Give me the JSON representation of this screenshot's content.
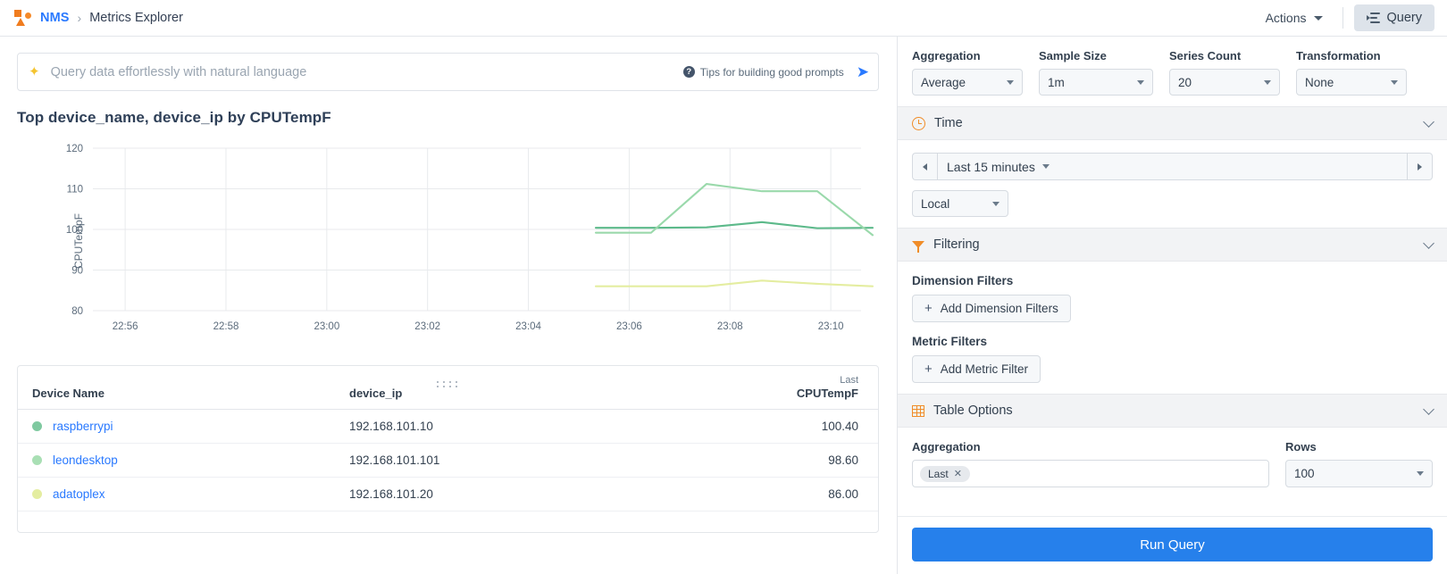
{
  "topbar": {
    "logo_icon": "nms-logo-icon",
    "breadcrumb_root": "NMS",
    "breadcrumb_separator": "›",
    "breadcrumb_current": "Metrics Explorer",
    "actions_label": "Actions",
    "query_label": "Query"
  },
  "nl_query": {
    "sparkle_icon": "sparkle-icon",
    "value": "",
    "placeholder": "Query data effortlessly with natural language",
    "tips_label": "Tips for building good prompts",
    "help_glyph": "?",
    "send_glyph": "➤"
  },
  "chart": {
    "title": "Top device_name, device_ip by CPUTempF"
  },
  "chart_data": {
    "type": "line",
    "title": "Top device_name, device_ip by CPUTempF",
    "xlabel": "",
    "ylabel": "CPUTempF",
    "ylim": [
      80,
      120
    ],
    "yticks": [
      80,
      90,
      100,
      110,
      120
    ],
    "xticks": [
      "22:56",
      "22:58",
      "23:00",
      "23:02",
      "23:04",
      "23:06",
      "23:08",
      "23:10"
    ],
    "grid": true,
    "legend": "none",
    "x": [
      "23:05",
      "23:06",
      "23:07",
      "23:08",
      "23:09",
      "23:10"
    ],
    "series": [
      {
        "name": "raspberrypi",
        "color": "#5cb98a",
        "values": [
          100.4,
          100.4,
          100.5,
          101.8,
          100.3,
          100.4
        ]
      },
      {
        "name": "leondesktop",
        "color": "#9ad9ab",
        "values": [
          99.2,
          99.2,
          111.2,
          109.4,
          109.4,
          98.6
        ]
      },
      {
        "name": "adatoplex",
        "color": "#e4eda0",
        "values": [
          86.0,
          86.0,
          86.0,
          87.4,
          86.6,
          86.0
        ]
      }
    ]
  },
  "resize_handle": {
    "name": "chart-resize-handle"
  },
  "table": {
    "columns": [
      {
        "key": "device_name",
        "label": "Device Name",
        "agg": "",
        "align": "left"
      },
      {
        "key": "device_ip",
        "label": "device_ip",
        "agg": "",
        "align": "left"
      },
      {
        "key": "cputempf",
        "label": "CPUTempF",
        "agg": "Last",
        "align": "right"
      }
    ],
    "rows": [
      {
        "dot": "#7fc9a0",
        "device_name": "raspberrypi",
        "device_ip": "192.168.101.10",
        "cputempf": "100.40"
      },
      {
        "dot": "#a9dfb4",
        "device_name": "leondesktop",
        "device_ip": "192.168.101.101",
        "cputempf": "98.60"
      },
      {
        "dot": "#e4eda0",
        "device_name": "adatoplex",
        "device_ip": "192.168.101.20",
        "cputempf": "86.00"
      }
    ]
  },
  "panel": {
    "top_controls": [
      {
        "label": "Aggregation",
        "value": "Average"
      },
      {
        "label": "Sample Size",
        "value": "1m"
      },
      {
        "label": "Series Count",
        "value": "20"
      },
      {
        "label": "Transformation",
        "value": "None"
      }
    ],
    "time": {
      "icon": "clock-icon",
      "title": "Time",
      "range_value": "Last 15 minutes",
      "timezone_value": "Local"
    },
    "filtering": {
      "icon": "funnel-icon",
      "title": "Filtering",
      "dimension_label": "Dimension Filters",
      "dimension_button": "Add Dimension Filters",
      "metric_label": "Metric Filters",
      "metric_button": "Add Metric Filter",
      "plus_glyph": "+"
    },
    "table_options": {
      "icon": "grid-icon",
      "title": "Table Options",
      "aggregation_label": "Aggregation",
      "aggregation_chip": "Last",
      "chip_close_glyph": "✕",
      "rows_label": "Rows",
      "rows_value": "100"
    },
    "run_button": "Run Query"
  },
  "colors": {
    "accent_blue": "#2680eb",
    "link_blue": "#2979ff",
    "brand_orange": "#f07c1e"
  }
}
